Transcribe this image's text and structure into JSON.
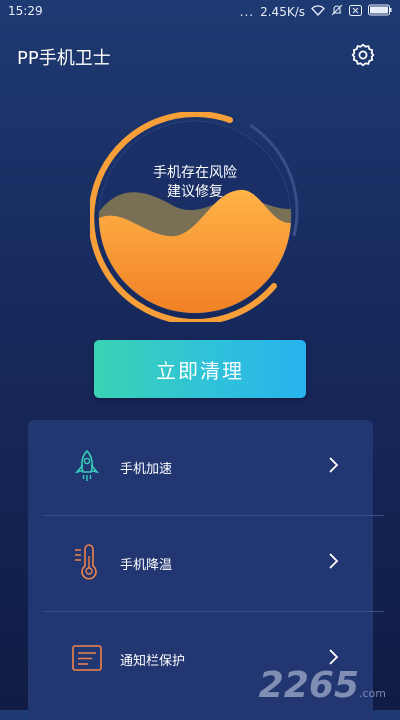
{
  "status_bar": {
    "time": "15:29",
    "dots": "...",
    "speed": "2.45K/s"
  },
  "header": {
    "title": "PP手机卫士"
  },
  "gauge": {
    "line1": "手机存在风险",
    "line2": "建议修复"
  },
  "actions": {
    "clean_label": "立即清理"
  },
  "menu": {
    "items": [
      {
        "label": "手机加速",
        "icon": "rocket-icon"
      },
      {
        "label": "手机降温",
        "icon": "thermometer-icon"
      },
      {
        "label": "通知栏保护",
        "icon": "notification-bar-icon"
      }
    ]
  },
  "watermark": {
    "big": "2265",
    "small": ".com"
  },
  "colors": {
    "accent_orange": "#f7a03a",
    "teal": "#36ceb9",
    "card": "#223671"
  }
}
